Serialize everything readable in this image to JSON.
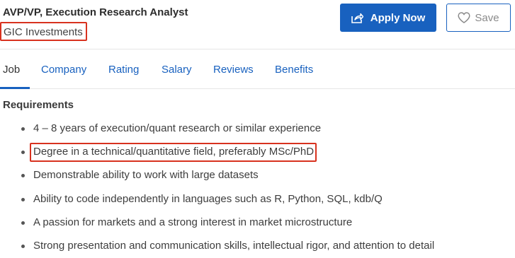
{
  "job": {
    "title": "AVP/VP, Execution Research Analyst",
    "company": "GIC Investments"
  },
  "actions": {
    "apply_label": "Apply Now",
    "save_label": "Save"
  },
  "tabs": [
    {
      "label": "Job",
      "active": true
    },
    {
      "label": "Company",
      "active": false
    },
    {
      "label": "Rating",
      "active": false
    },
    {
      "label": "Salary",
      "active": false
    },
    {
      "label": "Reviews",
      "active": false
    },
    {
      "label": "Benefits",
      "active": false
    }
  ],
  "requirements": {
    "heading": "Requirements",
    "items": [
      "4 – 8 years of execution/quant research or similar experience",
      "Degree in a technical/quantitative field, preferably MSc/PhD",
      "Demonstrable ability to work with large datasets",
      "Ability to code independently in languages such as R, Python, SQL, kdb/Q",
      "A passion for markets and a strong interest in market microstructure",
      "Strong presentation and communication skills, intellectual rigor, and attention to detail"
    ]
  },
  "colors": {
    "primary": "#1861bf",
    "highlight_border": "#d8321f"
  },
  "icons": {
    "apply": "share-arrow-icon",
    "save": "heart-outline-icon"
  }
}
